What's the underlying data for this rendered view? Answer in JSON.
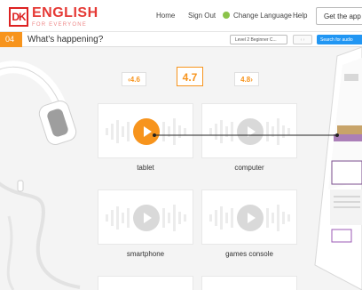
{
  "header": {
    "logo_mark": "DK",
    "logo_title": "ENGLISH",
    "logo_subtitle": "FOR EVERYONE",
    "nav": [
      "Home",
      "Sign Out",
      "Change Language",
      "Help"
    ],
    "get_app": "Get the app"
  },
  "lesson": {
    "number": "04",
    "title": "What's happening?",
    "level": "Level 2 Beginner C...",
    "search": "Search for audio"
  },
  "pager": {
    "prev": "4.6",
    "current": "4.7",
    "next": "4.8"
  },
  "cards": [
    {
      "label": "tablet",
      "active": true
    },
    {
      "label": "computer",
      "active": false
    },
    {
      "label": "smartphone",
      "active": false
    },
    {
      "label": "games console",
      "active": false
    }
  ],
  "colors": {
    "accent": "#f7941d",
    "brand": "#e53935",
    "search_button": "#2196f3"
  }
}
